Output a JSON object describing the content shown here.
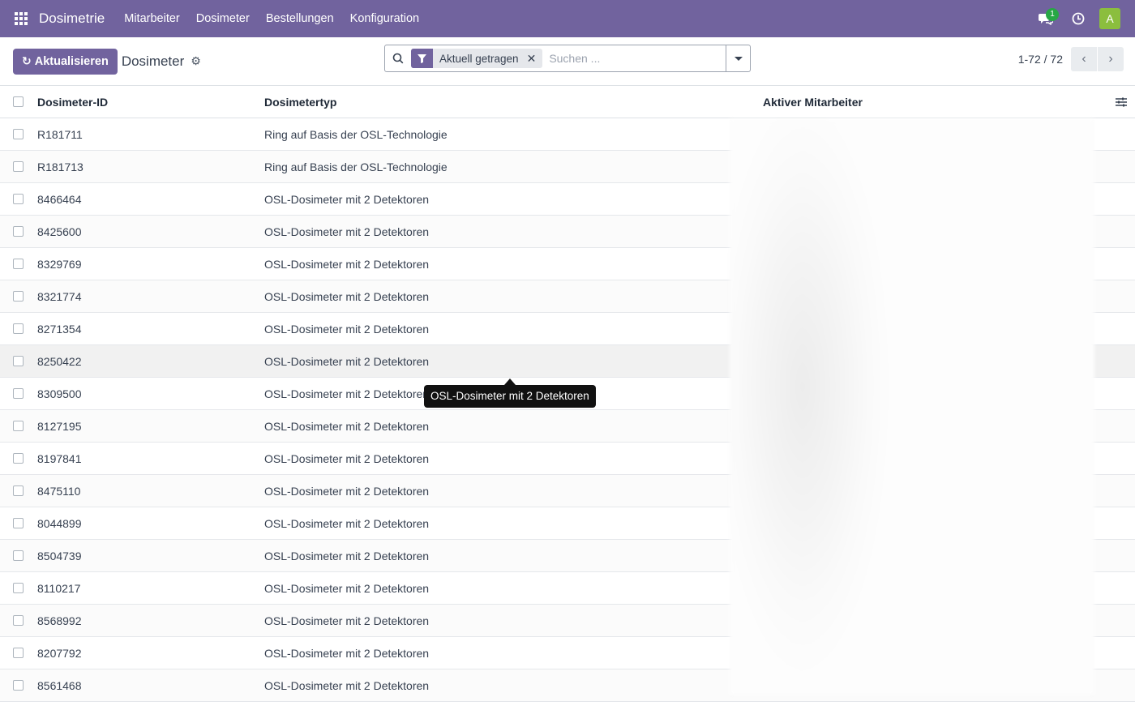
{
  "navbar": {
    "app_name": "Dosimetrie",
    "menu": [
      "Mitarbeiter",
      "Dosimeter",
      "Bestellungen",
      "Konfiguration"
    ],
    "messages_badge": "1",
    "avatar_letter": "A",
    "accent_color": "#71639e"
  },
  "control_panel": {
    "refresh_label": "Aktualisieren",
    "breadcrumb_title": "Dosimeter",
    "search": {
      "facet_label": "Aktuell getragen",
      "placeholder": "Suchen ..."
    },
    "pager_value": "1-72 / 72"
  },
  "list": {
    "columns": [
      "Dosimeter-ID",
      "Dosimetertyp",
      "Aktiver Mitarbeiter"
    ],
    "rows": [
      {
        "id": "R181711",
        "type": "Ring auf Basis der OSL-Technologie"
      },
      {
        "id": "R181713",
        "type": "Ring auf Basis der OSL-Technologie"
      },
      {
        "id": "8466464",
        "type": "OSL-Dosimeter mit 2 Detektoren"
      },
      {
        "id": "8425600",
        "type": "OSL-Dosimeter mit 2 Detektoren"
      },
      {
        "id": "8329769",
        "type": "OSL-Dosimeter mit 2 Detektoren"
      },
      {
        "id": "8321774",
        "type": "OSL-Dosimeter mit 2 Detektoren"
      },
      {
        "id": "8271354",
        "type": "OSL-Dosimeter mit 2 Detektoren"
      },
      {
        "id": "8250422",
        "type": "OSL-Dosimeter mit 2 Detektoren"
      },
      {
        "id": "8309500",
        "type": "OSL-Dosimeter mit 2 Detektoren"
      },
      {
        "id": "8127195",
        "type": "OSL-Dosimeter mit 2 Detektoren"
      },
      {
        "id": "8197841",
        "type": "OSL-Dosimeter mit 2 Detektoren"
      },
      {
        "id": "8475110",
        "type": "OSL-Dosimeter mit 2 Detektoren"
      },
      {
        "id": "8044899",
        "type": "OSL-Dosimeter mit 2 Detektoren"
      },
      {
        "id": "8504739",
        "type": "OSL-Dosimeter mit 2 Detektoren"
      },
      {
        "id": "8110217",
        "type": "OSL-Dosimeter mit 2 Detektoren"
      },
      {
        "id": "8568992",
        "type": "OSL-Dosimeter mit 2 Detektoren"
      },
      {
        "id": "8207792",
        "type": "OSL-Dosimeter mit 2 Detektoren"
      },
      {
        "id": "8561468",
        "type": "OSL-Dosimeter mit 2 Detektoren"
      }
    ],
    "hover_row_index": 7
  },
  "tooltip": {
    "text": "OSL-Dosimeter mit 2 Detektoren"
  }
}
